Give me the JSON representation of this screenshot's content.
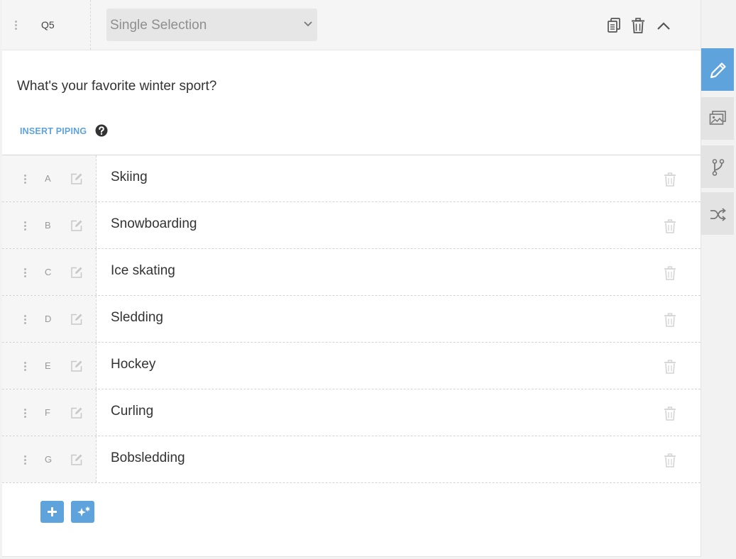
{
  "question": {
    "number": "Q5",
    "type": "Single Selection",
    "text": "What's your favorite winter sport?",
    "insert_piping": "INSERT PIPING"
  },
  "answers": [
    {
      "letter": "A",
      "text": "Skiing"
    },
    {
      "letter": "B",
      "text": "Snowboarding"
    },
    {
      "letter": "C",
      "text": "Ice skating"
    },
    {
      "letter": "D",
      "text": "Sledding"
    },
    {
      "letter": "E",
      "text": "Hockey"
    },
    {
      "letter": "F",
      "text": "Curling"
    },
    {
      "letter": "G",
      "text": "Bobsledding"
    }
  ],
  "icons": {
    "header": [
      "copy-icon",
      "trash-icon",
      "chevron-up-icon"
    ],
    "sidebar": [
      "pencil-icon",
      "images-icon",
      "branch-icon",
      "shuffle-icon"
    ],
    "footer": [
      "plus-icon",
      "magic-icon"
    ]
  },
  "colors": {
    "accent": "#5fa3dc",
    "sidebar_tab": "#e3e3e3",
    "header_bg": "#f5f5f5"
  }
}
